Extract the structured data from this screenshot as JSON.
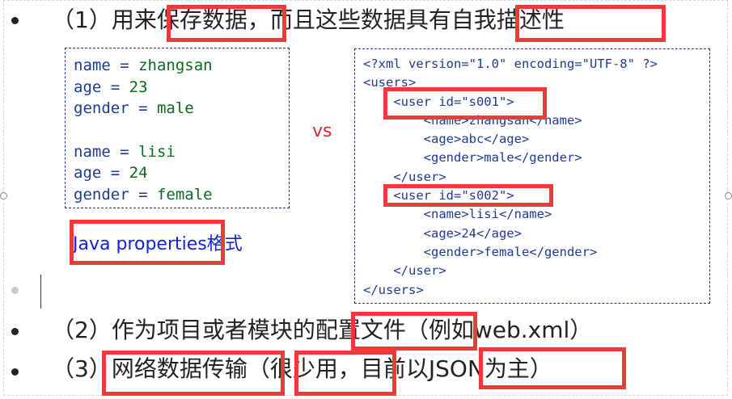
{
  "bullets": [
    {
      "prefix": "（1）用来",
      "hl1": "保存数据",
      "mid": "，而且这些数据具有",
      "hl2": "自我描述性",
      "suffix": ""
    },
    {
      "prefix": "（2）作为项目或者模块的",
      "hl1": "配置文件",
      "mid": "（例如web.xml）",
      "hl2": "",
      "suffix": ""
    },
    {
      "prefix": "（3）",
      "hl1": "网络数据传输",
      "mid": "（",
      "hl2": "很少用，",
      "suffix": "目前以",
      "hl3": "JSON为主",
      "tail": "）"
    }
  ],
  "properties": {
    "lines": [
      {
        "key": "name",
        "eq": " = ",
        "val": "zhangsan"
      },
      {
        "key": "age",
        "eq": " = ",
        "val": "23"
      },
      {
        "key": "gender",
        "eq": " = ",
        "val": "male"
      },
      {
        "key": "",
        "eq": "",
        "val": ""
      },
      {
        "key": "name",
        "eq": " = ",
        "val": "lisi"
      },
      {
        "key": "age",
        "eq": " = ",
        "val": "24"
      },
      {
        "key": "gender",
        "eq": " = ",
        "val": "female"
      }
    ],
    "label_a": "Java properties",
    "label_b": "格式"
  },
  "vs": "vs",
  "xml": {
    "lines": [
      "<?xml version=\"1.0\" encoding=\"UTF-8\" ?>",
      "<users>",
      "    <user id=\"s001\">",
      "        <name>zhangsan</name>",
      "        <age>abc</age>",
      "        <gender>male</gender>",
      "    </user>",
      "    <user id=\"s002\">",
      "        <name>lisi</name>",
      "        <age>24</age>",
      "        <gender>female</gender>",
      "    </user>",
      "</users>"
    ]
  },
  "colors": {
    "highlight": "#ee3a3a",
    "key": "#1f3a93",
    "value": "#0a6b1f",
    "link": "#1024d8"
  }
}
